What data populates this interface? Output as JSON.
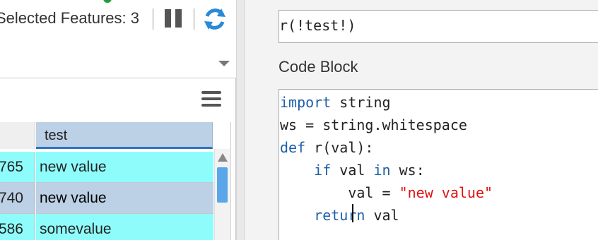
{
  "toolbar": {
    "selected_features": "Selected Features: 3",
    "pause_icon": "pause-icon",
    "refresh_icon": "refresh-icon"
  },
  "table": {
    "column_header": "test",
    "rows": [
      {
        "num": "765",
        "value": "new value",
        "selected": false
      },
      {
        "num": "740",
        "value": "new value",
        "selected": true
      },
      {
        "num": "586",
        "value": "somevalue",
        "selected": false
      }
    ]
  },
  "expression": {
    "value": "r(!test!)"
  },
  "code_block": {
    "label": "Code Block",
    "lines": [
      {
        "kw": "import",
        "rest": " string"
      },
      {
        "plain": "ws = string.whitespace"
      },
      {
        "kw": "def",
        "rest": " r(val):"
      },
      {
        "indent": "    ",
        "kw": "if",
        "mid": " val ",
        "kw2": "in",
        "rest": " ws:"
      },
      {
        "indent": "        ",
        "pre": "val = ",
        "str": "\"new value\""
      },
      {
        "indent": "    ",
        "kw": "return",
        "rest": " val"
      }
    ]
  },
  "colors": {
    "keyword": "#1f5fa6",
    "string": "#e01010",
    "row_highlight": "#8ffcfc",
    "row_selected": "#bcd0e6",
    "accent": "#2f73c4"
  }
}
